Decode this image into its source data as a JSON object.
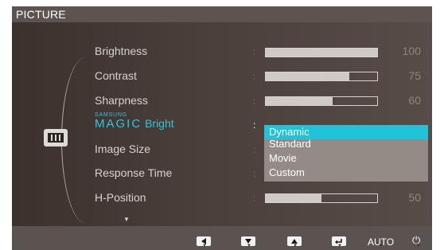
{
  "header": {
    "title": "PICTURE"
  },
  "category_icon": "picture-category-icon",
  "menu": {
    "items": [
      {
        "label": "Brightness",
        "value": "100",
        "level": 100
      },
      {
        "label": "Contrast",
        "value": "75",
        "level": 75
      },
      {
        "label": "Sharpness",
        "value": "60",
        "level": 60
      },
      {
        "label_prefix_small": "SAMSUNG",
        "label_prefix": "MAGIC",
        "label": "Bright",
        "selected": true
      },
      {
        "label": "Image Size"
      },
      {
        "label": "Response Time"
      },
      {
        "label": "H-Position",
        "value": "50",
        "level": 50
      }
    ],
    "more_indicator": "▼"
  },
  "dropdown": {
    "options": [
      "Dynamic",
      "Standard",
      "Movie",
      "Custom"
    ],
    "selected": "Dynamic"
  },
  "footer": {
    "buttons": [
      {
        "name": "left-button",
        "icon": "triangle-left-icon"
      },
      {
        "name": "down-button",
        "icon": "triangle-down-icon"
      },
      {
        "name": "up-button",
        "icon": "triangle-up-icon"
      },
      {
        "name": "enter-button",
        "icon": "enter-icon"
      },
      {
        "name": "auto-button",
        "label": "AUTO"
      },
      {
        "name": "power-button",
        "icon": "power-icon"
      }
    ],
    "auto_label": "AUTO",
    "power_glyph": "⏻"
  },
  "colors": {
    "accent": "#20c3d8",
    "osd_background": "#463b37",
    "header_background": "#5d5450"
  }
}
